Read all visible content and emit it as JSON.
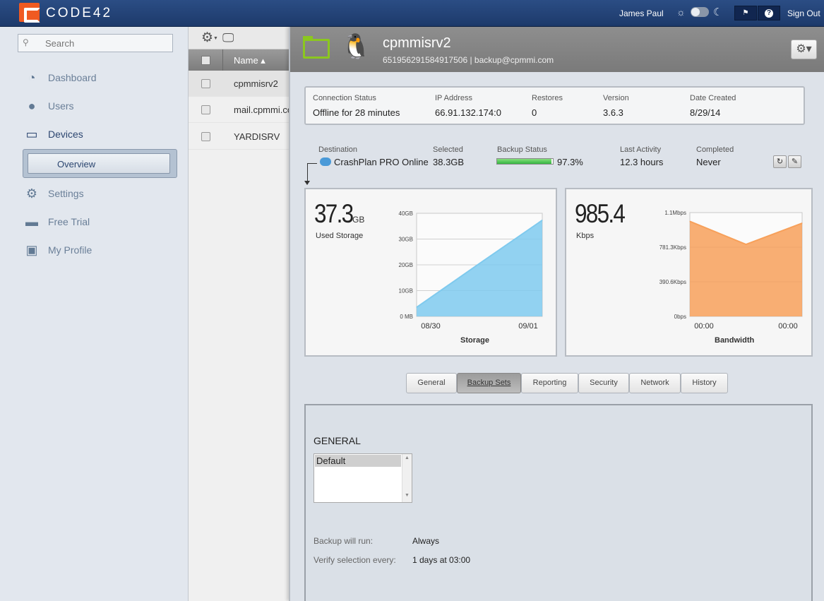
{
  "topbar": {
    "brand": "CODE42",
    "username": "James Paul",
    "signout": "Sign Out",
    "icons": [
      "sun-icon",
      "theme-toggle",
      "moon-icon",
      "flag-icon",
      "help-icon"
    ]
  },
  "sidebar": {
    "search_placeholder": "Search",
    "items": [
      {
        "label": "Dashboard",
        "icon": "dashboard-icon"
      },
      {
        "label": "Users",
        "icon": "user-icon"
      },
      {
        "label": "Devices",
        "icon": "monitor-icon"
      },
      {
        "label": "Overview",
        "icon": ""
      },
      {
        "label": "Settings",
        "icon": "gears-icon"
      },
      {
        "label": "Free Trial",
        "icon": "card-icon"
      },
      {
        "label": "My Profile",
        "icon": "profile-icon"
      }
    ]
  },
  "devlist": {
    "column_name": "Name",
    "rows": [
      "cpmmisrv2",
      "mail.cpmmi.com",
      "YARDISRV"
    ]
  },
  "device": {
    "name": "cpmmisrv2",
    "subtitle": "651956291584917506 | backup@cpmmi.com"
  },
  "info": {
    "headers": [
      "Connection Status",
      "IP Address",
      "Restores",
      "Version",
      "Date Created"
    ],
    "values": [
      "Offline for 28 minutes",
      "66.91.132.174:0",
      "0",
      "3.6.3",
      "8/29/14"
    ]
  },
  "destination": {
    "headers": [
      "Destination",
      "Selected",
      "Backup Status",
      "Last Activity",
      "Completed"
    ],
    "name": "CrashPlan PRO Online",
    "selected": "38.3GB",
    "backup_percent_text": "97.3%",
    "backup_fraction": 0.973,
    "last_activity": "12.3 hours",
    "completed": "Never"
  },
  "storage": {
    "big": "37.3",
    "unit": "GB",
    "sub": "Used Storage",
    "title": "Storage"
  },
  "bandwidth": {
    "big": "985.4",
    "sub": "Kbps",
    "title": "Bandwidth"
  },
  "chart_data": [
    {
      "type": "area",
      "title": "Storage",
      "x": [
        "08/30",
        "",
        "09/01"
      ],
      "yticks": [
        "40GB",
        "30GB",
        "20GB",
        "10GB",
        "0 MB"
      ],
      "ylim": [
        0,
        40
      ],
      "series": [
        {
          "values": [
            3.5,
            20.5,
            37.3
          ]
        }
      ],
      "color": "#7fcaee",
      "grid": true
    },
    {
      "type": "area",
      "title": "Bandwidth",
      "x": [
        "00:00",
        "",
        "00:00"
      ],
      "yticks": [
        "1.1Mbps",
        "781.3Kbps",
        "390.6Kbps",
        "0bps"
      ],
      "ylim": [
        0,
        1125
      ],
      "series": [
        {
          "values": [
            1030,
            780,
            1010
          ]
        }
      ],
      "color": "#f7a05a",
      "grid": true
    }
  ],
  "tabs": [
    "General",
    "Backup Sets",
    "Reporting",
    "Security",
    "Network",
    "History"
  ],
  "active_tab": "Backup Sets",
  "panel": {
    "title": "GENERAL",
    "list_selected": "Default",
    "backup_label": "Backup will run:",
    "backup_value": "Always",
    "verify_label": "Verify selection every:",
    "verify_value": "1 days at 03:00"
  }
}
